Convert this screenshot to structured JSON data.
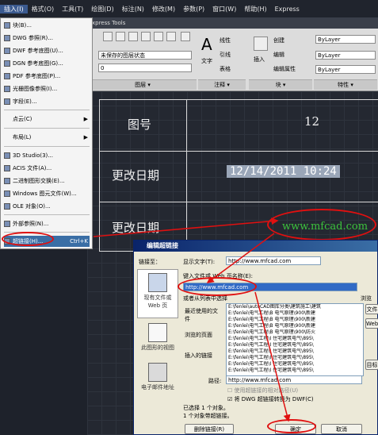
{
  "menubar": [
    "插入(I)",
    "格式(O)",
    "工具(T)",
    "绘图(D)",
    "标注(N)",
    "修改(M)",
    "参数(P)",
    "窗口(W)",
    "帮助(H)",
    "Express"
  ],
  "ribbon": {
    "tab_label": "xpress Tools",
    "layer_state": "未保存的图层状态",
    "layer_current": "0",
    "panel_layers": "图层 ▾",
    "panel_annotation": "注释 ▾",
    "panel_block": "块 ▾",
    "panel_properties": "特性 ▾",
    "text_label": "文字",
    "linear_label": "线性",
    "leader_label": "引线",
    "table_label": "表格",
    "insert_label": "插入",
    "create_label": "创建",
    "edit_label": "编辑",
    "edit_attr_label": "编辑属性",
    "bylayer1": "ByLayer",
    "bylayer2": "ByLayer",
    "bylayer3": "ByLayer"
  },
  "drawing": {
    "label_drawing_no": "图号",
    "value_drawing_no": "12",
    "label_modified_date": "更改日期",
    "value_modified_date": "12/14/2011 10:24",
    "label_modified_date2": "更改日期",
    "hyperlink_text": "www.mfcad.com"
  },
  "menu": {
    "items": [
      "块(B)...",
      "DWG 参照(R)...",
      "DWF 参考底图(U)...",
      "DGN 参考底图(G)...",
      "PDF 参考底图(P)...",
      "光栅图像参照(I)...",
      "字段(E)...",
      "点云(C)",
      "布局(L)",
      "3D Studio(3)...",
      "ACIS 文件(A)...",
      "二进制图形交换(E)...",
      "Windows 图元文件(W)...",
      "OLE 对象(O)...",
      "外部参照(N)...",
      "超链接(H)..."
    ],
    "hyperlink_shortcut": "Ctrl+K"
  },
  "dialog": {
    "title": "编辑超链接",
    "link_to": "链接至：",
    "display_text_label": "显示文字(T):",
    "display_text_value": "http://www.mfcad.com",
    "type_file_label": "键入文件或 Web 页名称(E):",
    "type_file_value": "http://www.mfcad.com",
    "or_select": "或者从列表中选择",
    "browse": "浏览",
    "file_btn": "文件",
    "web_btn": "Web",
    "target_btn": "目标",
    "recent_files": "最近使用的文件",
    "browsed_pages": "浏览的页面",
    "inserted_links": "插入的链接",
    "path_label": "路径:",
    "path_value": "http://www.mfcad.com",
    "relative_path": "使用超链接的相对路径(U)",
    "convert_dwg": "将 DWG 超链接转换为 DWF(C)",
    "status1": "已选择 1 个对象。",
    "status2": "1 个对象带超链接。",
    "remove_link": "删除链接(R)",
    "ok": "确定",
    "cancel": "取消",
    "side_existing": "现有文件或 Web 页",
    "side_view": "此图形的视图",
    "side_email": "电子邮件地址",
    "list": [
      "E:\\fenlei\\autoCAD图库分类\\建筑施工\\建筑",
      "E:\\fenlei\\电气工程\\B 电气原理\\900\\新建",
      "E:\\fenlei\\电气工程\\B 电气原理\\900\\新建",
      "E:\\fenlei\\电气工程\\B 电气原理\\900\\新建",
      "E:\\fenlei\\电气工程\\B 电气原理\\900\\防火",
      "E:\\fenlei\\电气工程\\I 住宅建筑电气\\895\\",
      "E:\\fenlei\\电气工程\\I 住宅建筑电气\\895\\",
      "E:\\fenlei\\电气工程\\I 住宅建筑电气\\895\\",
      "E:\\fenlei\\电气工程\\I 住宅建筑电气\\895\\",
      "E:\\fenlei\\电气工程\\I 住宅建筑电气\\895\\",
      "E:\\fenlei\\电气工程\\I 住宅建筑电气\\895\\"
    ]
  }
}
